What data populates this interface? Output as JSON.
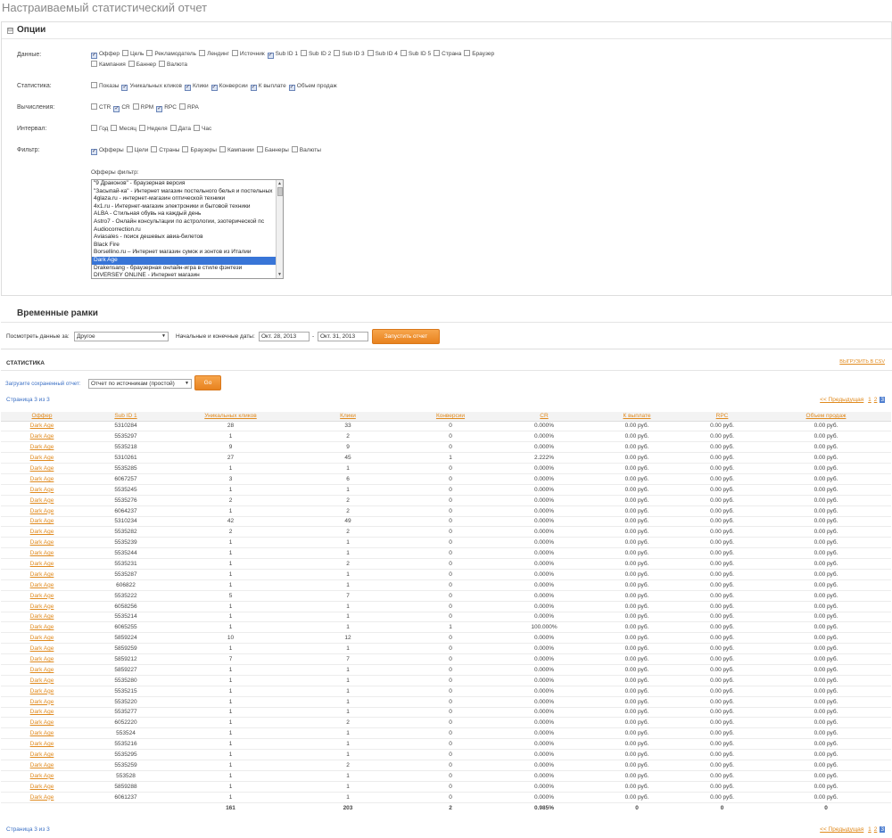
{
  "page_title": "Настраиваемый статистический отчет",
  "options": {
    "title": "Опции",
    "toggle": "⊟",
    "rows": [
      {
        "label": "Данные:",
        "items": [
          {
            "label": "Оффер",
            "checked": true
          },
          {
            "label": "Цель",
            "checked": false
          },
          {
            "label": "Рекламодатель",
            "checked": false
          },
          {
            "label": "Лендинг",
            "checked": false
          },
          {
            "label": "Источник",
            "checked": false
          },
          {
            "label": "Sub ID 1",
            "checked": true
          },
          {
            "label": "Sub ID 2",
            "checked": false
          },
          {
            "label": "Sub ID 3",
            "checked": false
          },
          {
            "label": "Sub ID 4",
            "checked": false
          },
          {
            "label": "Sub ID 5",
            "checked": false
          },
          {
            "label": "Страна",
            "checked": false
          },
          {
            "label": "Браузер",
            "checked": false
          },
          {
            "label": "Кампания",
            "checked": false
          },
          {
            "label": "Баннер",
            "checked": false
          },
          {
            "label": "Валюта",
            "checked": false
          }
        ]
      },
      {
        "label": "Статистика:",
        "items": [
          {
            "label": "Показы",
            "checked": false
          },
          {
            "label": "Уникальных кликов",
            "checked": true
          },
          {
            "label": "Клики",
            "checked": true
          },
          {
            "label": "Конверсии",
            "checked": true
          },
          {
            "label": "К выплате",
            "checked": true
          },
          {
            "label": "Объем продаж",
            "checked": true
          }
        ]
      },
      {
        "label": "Вычисления:",
        "items": [
          {
            "label": "CTR",
            "checked": false
          },
          {
            "label": "CR",
            "checked": true
          },
          {
            "label": "RPM",
            "checked": false
          },
          {
            "label": "RPC",
            "checked": true
          },
          {
            "label": "RPA",
            "checked": false
          }
        ]
      },
      {
        "label": "Интервал:",
        "items": [
          {
            "label": "Год",
            "checked": false
          },
          {
            "label": "Месяц",
            "checked": false
          },
          {
            "label": "Неделя",
            "checked": false
          },
          {
            "label": "Дата",
            "checked": false
          },
          {
            "label": "Час",
            "checked": false
          }
        ]
      },
      {
        "label": "Фильтр:",
        "items": [
          {
            "label": "Офферы",
            "checked": true
          },
          {
            "label": "Цели",
            "checked": false
          },
          {
            "label": "Страны",
            "checked": false
          },
          {
            "label": "Браузеры",
            "checked": false
          },
          {
            "label": "Кампании",
            "checked": false
          },
          {
            "label": "Баннеры",
            "checked": false
          },
          {
            "label": "Валюты",
            "checked": false
          }
        ]
      }
    ],
    "offers_filter_label": "Офферы фильтр:",
    "offers": [
      {
        "label": "\"9 Драконов\" - браузерная версия",
        "selected": false
      },
      {
        "label": "\"Засыпай-ка\" - Интернет магазин постельного белья и постельных",
        "selected": false
      },
      {
        "label": "4glaza.ru - интернет-магазин оптической техники",
        "selected": false
      },
      {
        "label": "4x1.ru - Интернет-магазин электроники и бытовой техники",
        "selected": false
      },
      {
        "label": "ALBA - Стильная обувь на каждый день",
        "selected": false
      },
      {
        "label": "Astro7 - Онлайн консультации по астрологии, эзотерической пс",
        "selected": false
      },
      {
        "label": "Audiocorrection.ru",
        "selected": false
      },
      {
        "label": "Aviasales - поиск дешевых авиа-билетов",
        "selected": false
      },
      {
        "label": "Black Fire",
        "selected": false
      },
      {
        "label": "Borsellino.ru – Интернет магазин сумок и зонтов из Италии",
        "selected": false
      },
      {
        "label": "Dark Age",
        "selected": true
      },
      {
        "label": "Drakensang - браузерная онлайн-игра в стиле фэнтези",
        "selected": false
      },
      {
        "label": "DIVERSEY ONLINE - Интернет магазин",
        "selected": false
      }
    ]
  },
  "timeframe": {
    "title": "Временные рамки",
    "period_label": "Посмотреть данные за:",
    "period_value": "Другое",
    "dates_label": "Начальные и конечные даты:",
    "start_date": "Окт. 28, 2013",
    "separator": "-",
    "end_date": "Окт. 31, 2013",
    "run_button": "Запустить отчет"
  },
  "stats": {
    "title": "СТАТИСТИКА",
    "csv_link": "ВЫГРУЗИТЬ В CSV",
    "saved_label": "Загрузите сохраненный отчет:",
    "saved_value": "Отчет по источникам (простой)",
    "go_button": "Go",
    "page_info": "Страница 3 из 3",
    "prev_link": "<< Предыдущая",
    "pages": [
      "1",
      "2",
      "3"
    ],
    "current_page": "3",
    "columns": [
      "Оффер",
      "Sub ID 1",
      "Уникальных кликов",
      "Клики",
      "Конверсии",
      "CR",
      "К выплате",
      "RPC",
      "Объем продаж"
    ],
    "rows": [
      [
        "Dark Age",
        "5310284",
        "28",
        "33",
        "0",
        "0.000%",
        "0.00 руб.",
        "0.00 руб.",
        "0.00 руб."
      ],
      [
        "Dark Age",
        "5535297",
        "1",
        "2",
        "0",
        "0.000%",
        "0.00 руб.",
        "0.00 руб.",
        "0.00 руб."
      ],
      [
        "Dark Age",
        "5535218",
        "9",
        "9",
        "0",
        "0.000%",
        "0.00 руб.",
        "0.00 руб.",
        "0.00 руб."
      ],
      [
        "Dark Age",
        "5310261",
        "27",
        "45",
        "1",
        "2.222%",
        "0.00 руб.",
        "0.00 руб.",
        "0.00 руб."
      ],
      [
        "Dark Age",
        "5535285",
        "1",
        "1",
        "0",
        "0.000%",
        "0.00 руб.",
        "0.00 руб.",
        "0.00 руб."
      ],
      [
        "Dark Age",
        "6067257",
        "3",
        "6",
        "0",
        "0.000%",
        "0.00 руб.",
        "0.00 руб.",
        "0.00 руб."
      ],
      [
        "Dark Age",
        "5535245",
        "1",
        "1",
        "0",
        "0.000%",
        "0.00 руб.",
        "0.00 руб.",
        "0.00 руб."
      ],
      [
        "Dark Age",
        "5535276",
        "2",
        "2",
        "0",
        "0.000%",
        "0.00 руб.",
        "0.00 руб.",
        "0.00 руб."
      ],
      [
        "Dark Age",
        "6064237",
        "1",
        "2",
        "0",
        "0.000%",
        "0.00 руб.",
        "0.00 руб.",
        "0.00 руб."
      ],
      [
        "Dark Age",
        "5310234",
        "42",
        "49",
        "0",
        "0.000%",
        "0.00 руб.",
        "0.00 руб.",
        "0.00 руб."
      ],
      [
        "Dark Age",
        "5535282",
        "2",
        "2",
        "0",
        "0.000%",
        "0.00 руб.",
        "0.00 руб.",
        "0.00 руб."
      ],
      [
        "Dark Age",
        "5535239",
        "1",
        "1",
        "0",
        "0.000%",
        "0.00 руб.",
        "0.00 руб.",
        "0.00 руб."
      ],
      [
        "Dark Age",
        "5535244",
        "1",
        "1",
        "0",
        "0.000%",
        "0.00 руб.",
        "0.00 руб.",
        "0.00 руб."
      ],
      [
        "Dark Age",
        "5535231",
        "1",
        "2",
        "0",
        "0.000%",
        "0.00 руб.",
        "0.00 руб.",
        "0.00 руб."
      ],
      [
        "Dark Age",
        "5535287",
        "1",
        "1",
        "0",
        "0.000%",
        "0.00 руб.",
        "0.00 руб.",
        "0.00 руб."
      ],
      [
        "Dark Age",
        "606822",
        "1",
        "1",
        "0",
        "0.000%",
        "0.00 руб.",
        "0.00 руб.",
        "0.00 руб."
      ],
      [
        "Dark Age",
        "5535222",
        "5",
        "7",
        "0",
        "0.000%",
        "0.00 руб.",
        "0.00 руб.",
        "0.00 руб."
      ],
      [
        "Dark Age",
        "6058256",
        "1",
        "1",
        "0",
        "0.000%",
        "0.00 руб.",
        "0.00 руб.",
        "0.00 руб."
      ],
      [
        "Dark Age",
        "5535214",
        "1",
        "1",
        "0",
        "0.000%",
        "0.00 руб.",
        "0.00 руб.",
        "0.00 руб."
      ],
      [
        "Dark Age",
        "6065255",
        "1",
        "1",
        "1",
        "100.000%",
        "0.00 руб.",
        "0.00 руб.",
        "0.00 руб."
      ],
      [
        "Dark Age",
        "5859224",
        "10",
        "12",
        "0",
        "0.000%",
        "0.00 руб.",
        "0.00 руб.",
        "0.00 руб."
      ],
      [
        "Dark Age",
        "5859259",
        "1",
        "1",
        "0",
        "0.000%",
        "0.00 руб.",
        "0.00 руб.",
        "0.00 руб."
      ],
      [
        "Dark Age",
        "5859212",
        "7",
        "7",
        "0",
        "0.000%",
        "0.00 руб.",
        "0.00 руб.",
        "0.00 руб."
      ],
      [
        "Dark Age",
        "5859227",
        "1",
        "1",
        "0",
        "0.000%",
        "0.00 руб.",
        "0.00 руб.",
        "0.00 руб."
      ],
      [
        "Dark Age",
        "5535280",
        "1",
        "1",
        "0",
        "0.000%",
        "0.00 руб.",
        "0.00 руб.",
        "0.00 руб."
      ],
      [
        "Dark Age",
        "5535215",
        "1",
        "1",
        "0",
        "0.000%",
        "0.00 руб.",
        "0.00 руб.",
        "0.00 руб."
      ],
      [
        "Dark Age",
        "5535220",
        "1",
        "1",
        "0",
        "0.000%",
        "0.00 руб.",
        "0.00 руб.",
        "0.00 руб."
      ],
      [
        "Dark Age",
        "5535277",
        "1",
        "1",
        "0",
        "0.000%",
        "0.00 руб.",
        "0.00 руб.",
        "0.00 руб."
      ],
      [
        "Dark Age",
        "6052220",
        "1",
        "2",
        "0",
        "0.000%",
        "0.00 руб.",
        "0.00 руб.",
        "0.00 руб."
      ],
      [
        "Dark Age",
        "553524",
        "1",
        "1",
        "0",
        "0.000%",
        "0.00 руб.",
        "0.00 руб.",
        "0.00 руб."
      ],
      [
        "Dark Age",
        "5535216",
        "1",
        "1",
        "0",
        "0.000%",
        "0.00 руб.",
        "0.00 руб.",
        "0.00 руб."
      ],
      [
        "Dark Age",
        "5535295",
        "1",
        "1",
        "0",
        "0.000%",
        "0.00 руб.",
        "0.00 руб.",
        "0.00 руб."
      ],
      [
        "Dark Age",
        "5535259",
        "1",
        "2",
        "0",
        "0.000%",
        "0.00 руб.",
        "0.00 руб.",
        "0.00 руб."
      ],
      [
        "Dark Age",
        "553528",
        "1",
        "1",
        "0",
        "0.000%",
        "0.00 руб.",
        "0.00 руб.",
        "0.00 руб."
      ],
      [
        "Dark Age",
        "5859288",
        "1",
        "1",
        "0",
        "0.000%",
        "0.00 руб.",
        "0.00 руб.",
        "0.00 руб."
      ],
      [
        "Dark Age",
        "6061237",
        "1",
        "1",
        "0",
        "0.000%",
        "0.00 руб.",
        "0.00 руб.",
        "0.00 руб."
      ]
    ],
    "totals": [
      "",
      "",
      "161",
      "203",
      "2",
      "0.985%",
      "0",
      "0",
      "0"
    ]
  }
}
